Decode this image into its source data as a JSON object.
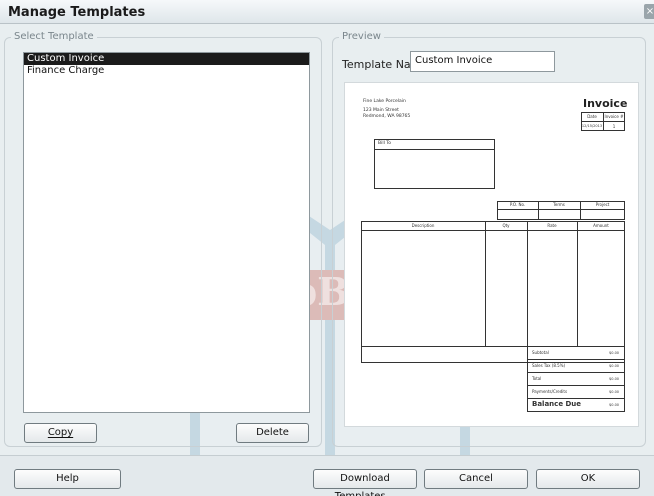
{
  "window": {
    "title": "Manage Templates",
    "close_glyph": "×"
  },
  "select_template": {
    "legend": "Select Template",
    "items": [
      {
        "label": "Custom Invoice",
        "selected": true
      },
      {
        "label": "Finance Charge",
        "selected": false
      }
    ],
    "copy_label": "Copy",
    "delete_label": "Delete"
  },
  "preview": {
    "legend": "Preview",
    "template_name_label": "Template Name",
    "template_name_value": "Custom Invoice",
    "invoice": {
      "company_lines": [
        "Fine Lake Porcelain",
        "123 Main Street",
        "Redmond, WA 98765"
      ],
      "title": "Invoice",
      "date_header": "Date",
      "invoice_no_header": "Invoice #",
      "date_value": "12/15/2013",
      "invoice_no_value": "1",
      "bill_to_label": "Bill To",
      "po_headers": [
        "P.O. No.",
        "Terms",
        "Project"
      ],
      "line_headers": [
        "Description",
        "Qty",
        "Rate",
        "Amount"
      ],
      "summary": [
        {
          "label": "Subtotal",
          "value": "$0.00"
        },
        {
          "label": "Sales Tax (8.5%)",
          "value": "$0.00"
        },
        {
          "label": "Total",
          "value": "$0.00"
        },
        {
          "label": "Payments/Credits",
          "value": "$0.00"
        }
      ],
      "balance_label": "Balance Due",
      "balance_value": "$0.00"
    }
  },
  "footer": {
    "help_label": "Help",
    "download_label": "Download Templates...",
    "cancel_label": "Cancel",
    "ok_label": "OK"
  },
  "watermark": {
    "text": "DropBooks",
    "color": "#c0392b",
    "book_color": "#5b8fb0"
  }
}
